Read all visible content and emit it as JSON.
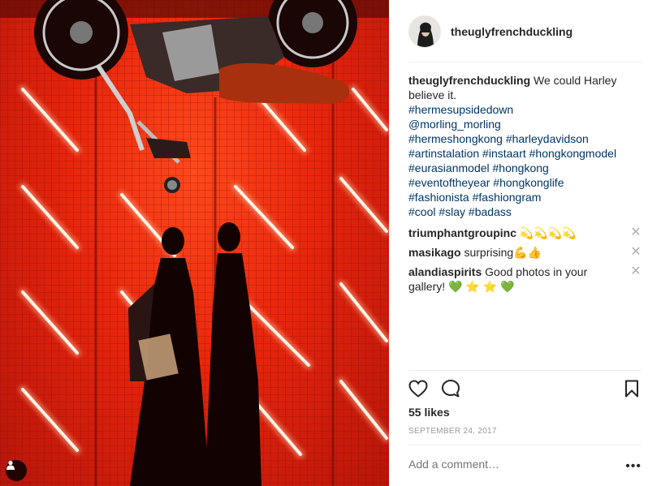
{
  "post": {
    "username": "theuglyfrenchduckling",
    "caption": {
      "username": "theuglyfrenchduckling",
      "text": "We could Harley believe it.",
      "tags": [
        "#hermesupsidedown",
        "@morling_morling",
        "#hermeshongkong #harleydavidson",
        "#artinstalation #instaart #hongkongmodel",
        "#eurasianmodel #hongkong",
        "#eventoftheyear #hongkonglife",
        "#fashionista #fashiongram",
        "#cool #slay #badass"
      ]
    },
    "comments": [
      {
        "username": "triumphantgroupinc",
        "text": "💫💫💫💫"
      },
      {
        "username": "masikago",
        "text": "surprising💪👍"
      },
      {
        "username": "alandiaspirits",
        "text": "Good photos in your gallery! 💚 ⭐ ⭐ 💚"
      }
    ],
    "likes": "55 likes",
    "date": "SEPTEMBER 24, 2017",
    "add_comment_placeholder": "Add a comment…",
    "more_label": "•••",
    "delete_label": "✕"
  },
  "icons": {
    "like": "heart-icon",
    "comment": "speech-bubble-icon",
    "save": "bookmark-icon",
    "tag": "user-tag-icon",
    "delete": "close-icon"
  },
  "colors": {
    "hashtag": "#003569",
    "text": "#262626",
    "muted": "#999999",
    "divider": "#efefef",
    "photo_red": "#e8250c"
  }
}
